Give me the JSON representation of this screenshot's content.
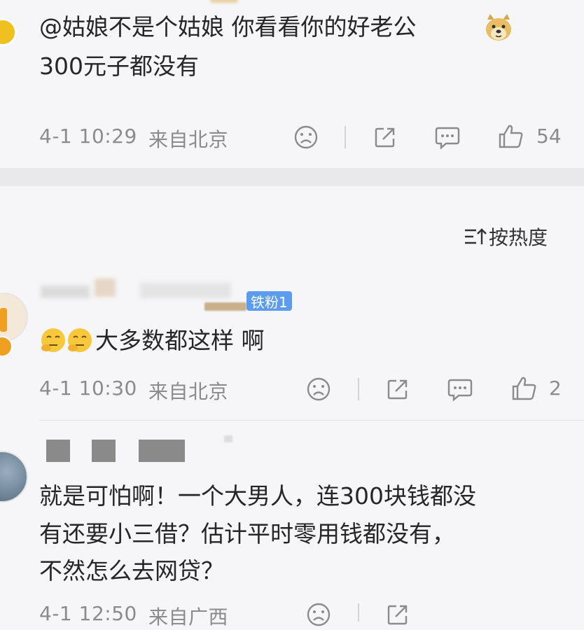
{
  "comment1": {
    "text_line1": "@姑娘不是个姑娘 你看看你的好老公",
    "text_line2": "300元子都没有",
    "time": "4-1 10:29",
    "location": "来自北京",
    "like_count": "54"
  },
  "sort": {
    "label": "按热度"
  },
  "comment2": {
    "badge": "铁粉1",
    "text": "大多数都这样 啊",
    "time": "4-1 10:30",
    "location": "来自北京",
    "like_count": "2"
  },
  "comment3": {
    "text_line1": "就是可怕啊！一个大男人，连300块钱都没",
    "text_line2": "有还要小三借？估计平时零用钱都没有，",
    "text_line3": "不然怎么去网贷？",
    "time": "4-1 12:50",
    "location": "来自广西"
  },
  "colors": {
    "badge_bg": "#5b9cf0",
    "avatar_accent": "#f0a020"
  }
}
